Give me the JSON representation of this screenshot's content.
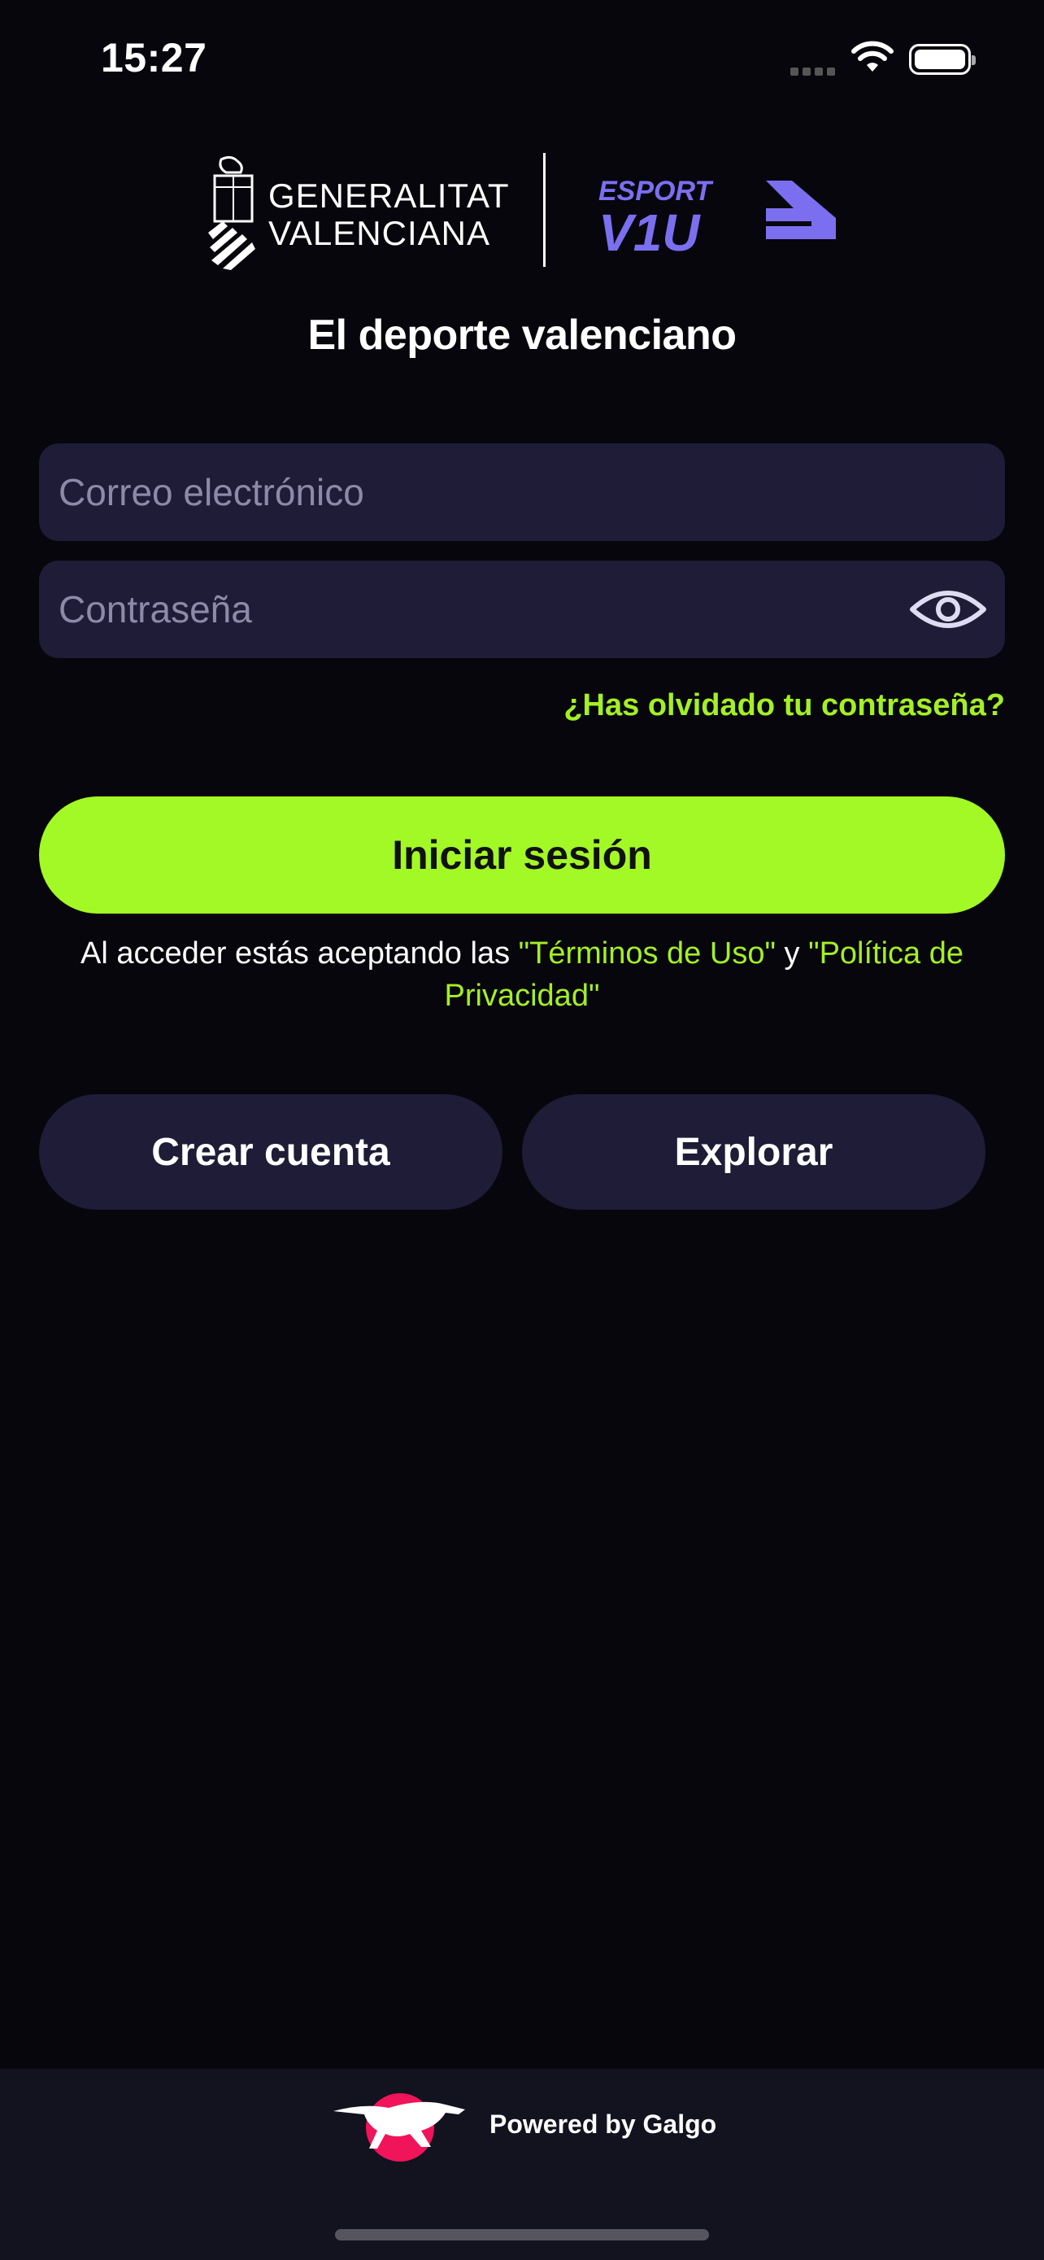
{
  "status_bar": {
    "time": "15:27"
  },
  "header": {
    "gv_line1": "GENERALITAT",
    "gv_line2": "VALENCIANA",
    "esport_word": "ESPORT",
    "v10_word": "V1U",
    "tagline": "El deporte valenciano"
  },
  "form": {
    "email_placeholder": "Correo electrónico",
    "password_placeholder": "Contraseña",
    "forgot_password": "¿Has olvidado tu contraseña?",
    "login_label": "Iniciar sesión"
  },
  "terms": {
    "prefix": "Al acceder estás aceptando las ",
    "terms_link": "\"Términos de Uso\"",
    "conjunction": " y ",
    "privacy_link": "\"Política de Privacidad\""
  },
  "actions": {
    "create_account": "Crear cuenta",
    "explore": "Explorar"
  },
  "footer": {
    "powered_by": "Powered by Galgo"
  },
  "colors": {
    "background": "#07060c",
    "accent": "#a3f925",
    "field_bg": "#1e1c36",
    "brand_purple": "#7b6ff0",
    "galgo_pink": "#f0145a"
  },
  "icons": [
    "wifi-icon",
    "battery-icon",
    "eye-icon",
    "gv-crest-logo",
    "esport-v10-logo",
    "galgo-logo"
  ]
}
